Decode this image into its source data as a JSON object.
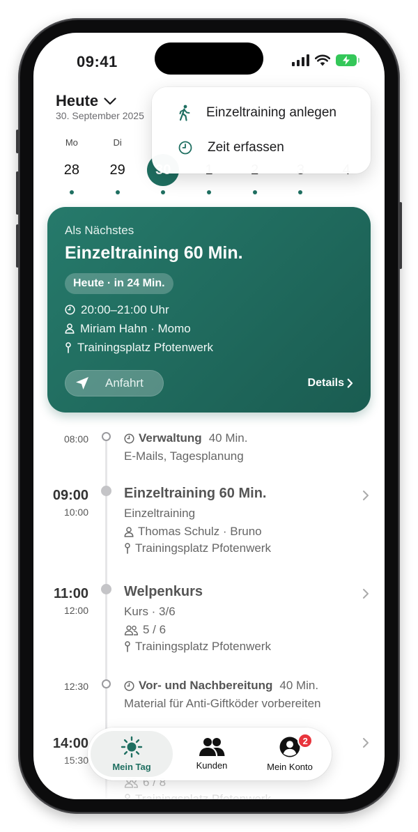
{
  "status_bar": {
    "time": "09:41"
  },
  "header": {
    "title": "Heute",
    "date": "30. September 2025"
  },
  "week": [
    {
      "name": "Mo",
      "num": "28"
    },
    {
      "name": "Di",
      "num": "29"
    },
    {
      "name": "",
      "num": "30"
    },
    {
      "name": "",
      "num": "1"
    },
    {
      "name": "",
      "num": "2"
    },
    {
      "name": "",
      "num": "3"
    },
    {
      "name": "",
      "num": "4"
    }
  ],
  "menu": {
    "items": [
      {
        "label": "Einzeltraining anlegen",
        "icon": "walking-person-icon"
      },
      {
        "label": "Zeit erfassen",
        "icon": "clock-icon"
      }
    ]
  },
  "next_card": {
    "eyebrow": "Als Nächstes",
    "title": "Einzeltraining 60 Min.",
    "badge": "Heute · in 24 Min.",
    "time": "20:00–21:00 Uhr",
    "person": "Miriam Hahn · Momo",
    "location": "Trainingsplatz Pfotenwerk",
    "route_label": "Anfahrt",
    "details_label": "Details"
  },
  "timeline": [
    {
      "time": "08:00",
      "title": "Verwaltung",
      "duration": "40 Min.",
      "sub": "E-Mails, Tagesplanung"
    },
    {
      "start": "09:00",
      "end": "10:00",
      "title": "Einzeltraining 60 Min.",
      "type": "Einzeltraining",
      "person": "Thomas Schulz · Bruno",
      "location": "Trainingsplatz Pfotenwerk"
    },
    {
      "start": "11:00",
      "end": "12:00",
      "title": "Welpenkurs",
      "type": "Kurs · 3/6",
      "capacity": "5 / 6",
      "location": "Trainingsplatz Pfotenwerk"
    },
    {
      "time": "12:30",
      "title": "Vor- und Nachbereitung",
      "duration": "40 Min.",
      "sub": "Material für Anti-Giftköder vorbereiten"
    },
    {
      "start": "14:00",
      "end": "15:30",
      "capacity": "6 / 8",
      "location": "Trainingsplatz Pfotenwerk"
    }
  ],
  "tabbar": {
    "tabs": [
      {
        "label": "Mein Tag"
      },
      {
        "label": "Kunden"
      },
      {
        "label": "Mein Konto",
        "badge": "2"
      }
    ]
  },
  "colors": {
    "accent": "#1f6f61",
    "badge": "#e8343c",
    "battery": "#34c759"
  }
}
